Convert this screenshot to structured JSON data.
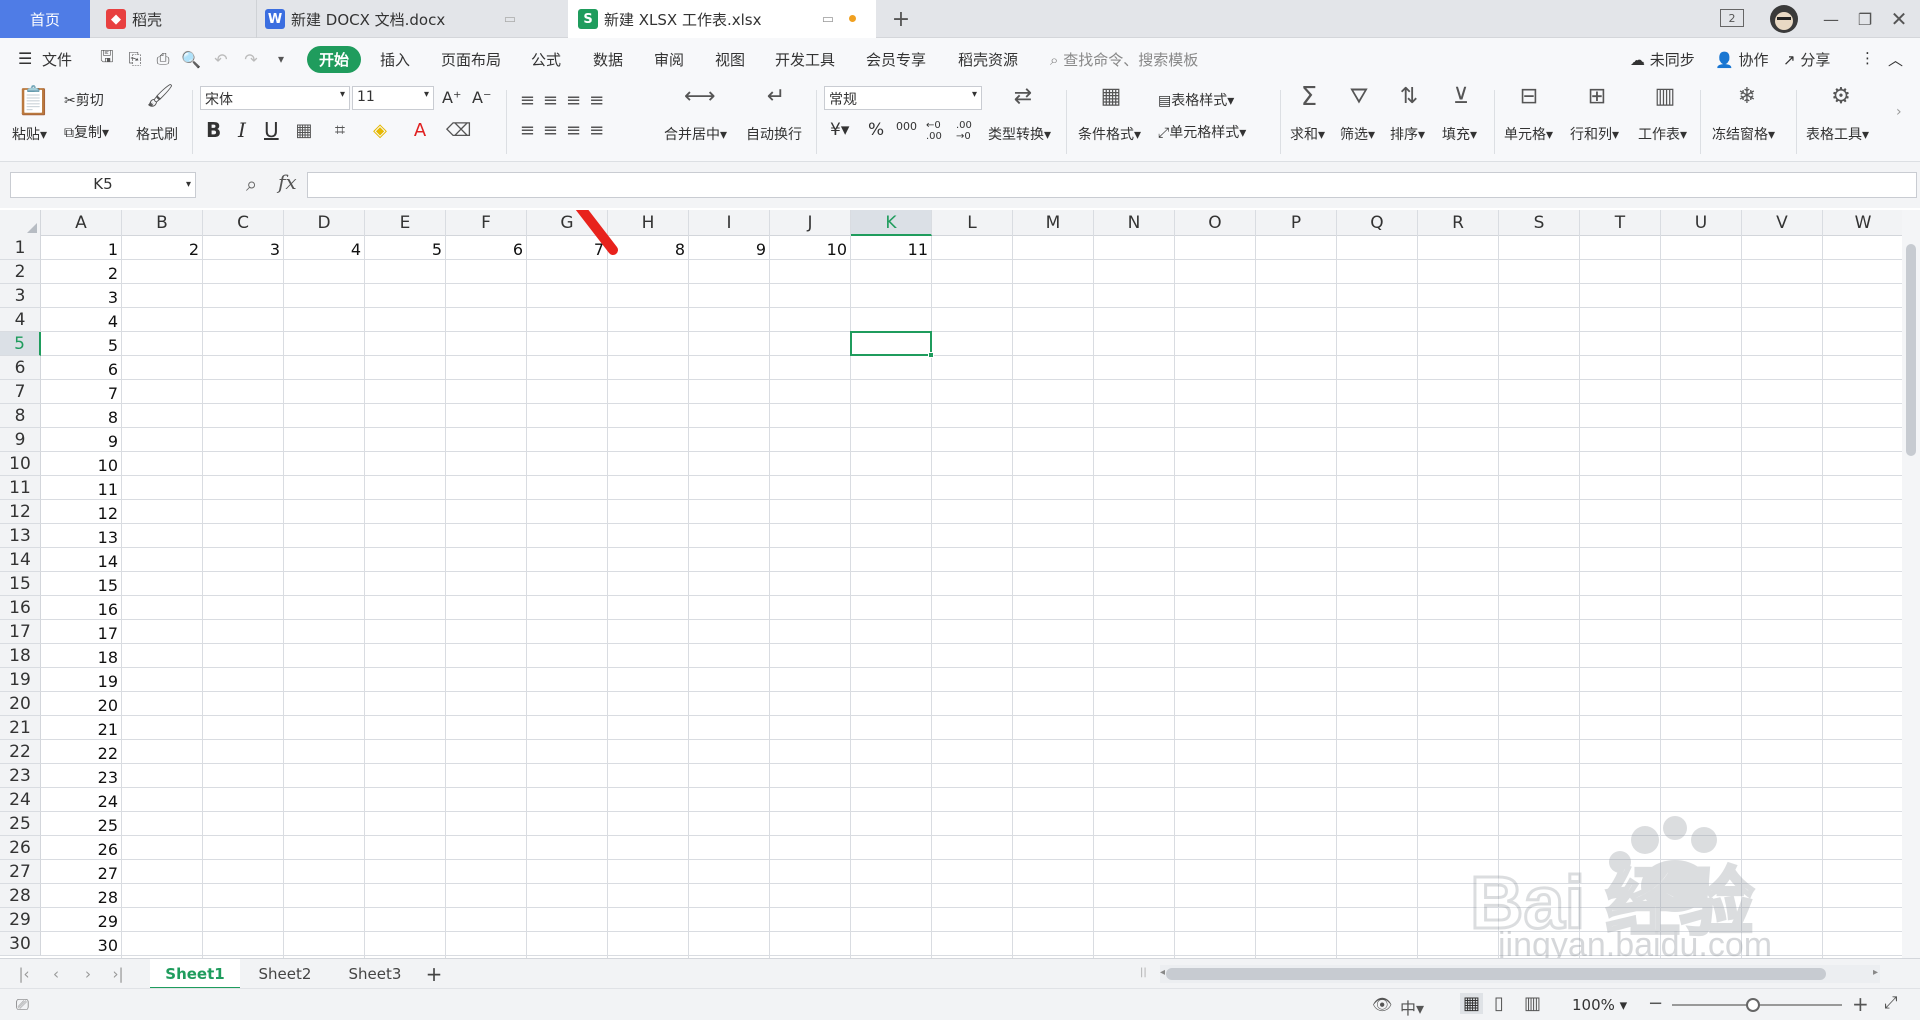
{
  "tabs": {
    "home": "首页",
    "daoke": "稻壳",
    "docx": "新建 DOCX 文档.docx",
    "xlsx": "新建 XLSX 工作表.xlsx",
    "add": "+",
    "window_count": "2"
  },
  "menu": {
    "file": "文件",
    "items": [
      "开始",
      "插入",
      "页面布局",
      "公式",
      "数据",
      "审阅",
      "视图",
      "开发工具",
      "会员专享",
      "稻壳资源"
    ],
    "search_placeholder": "查找命令、搜索模板",
    "unsynced": "未同步",
    "collab": "协作",
    "share": "分享"
  },
  "ribbon": {
    "paste": "粘贴",
    "cut": "剪切",
    "copy": "复制",
    "format_painter": "格式刷",
    "font": "宋体",
    "font_size": "11",
    "bold": "B",
    "italic": "I",
    "underline": "U",
    "grow": "A⁺",
    "shrink": "A⁻",
    "merge_center": "合并居中",
    "wrap": "自动换行",
    "number_format": "常规",
    "currency": "¥",
    "percent": "%",
    "thousands": "000",
    "inc_dec": "←0 .00",
    "dec_dec": ".00 →0",
    "type_convert": "类型转换",
    "cond_format": "条件格式",
    "table_style": "表格样式",
    "cell_style": "单元格样式",
    "sum": "求和",
    "filter": "筛选",
    "sort": "排序",
    "fill": "填充",
    "cell": "单元格",
    "rowcol": "行和列",
    "worksheet": "工作表",
    "freeze": "冻结窗格",
    "table_tools": "表格工具"
  },
  "formula": {
    "name_box": "K5",
    "fx": "fx",
    "content": ""
  },
  "sheet": {
    "columns": [
      "A",
      "B",
      "C",
      "D",
      "E",
      "F",
      "G",
      "H",
      "I",
      "J",
      "K",
      "L",
      "M",
      "N",
      "O",
      "P",
      "Q",
      "R",
      "S",
      "T",
      "U",
      "V",
      "W"
    ],
    "rows": [
      "1",
      "2",
      "3",
      "4",
      "5",
      "6",
      "7",
      "8",
      "9",
      "10",
      "11",
      "12",
      "13",
      "14",
      "15",
      "16",
      "17",
      "18",
      "19",
      "20",
      "21",
      "22",
      "23",
      "24",
      "25",
      "26",
      "27",
      "28",
      "29",
      "30"
    ],
    "active_col": "K",
    "active_row": "5",
    "row1_values": [
      "1",
      "2",
      "3",
      "4",
      "5",
      "6",
      "7",
      "8",
      "9",
      "10",
      "11"
    ],
    "colA_values": [
      "1",
      "2",
      "3",
      "4",
      "5",
      "6",
      "7",
      "8",
      "9",
      "10",
      "11",
      "12",
      "13",
      "14",
      "15",
      "16",
      "17",
      "18",
      "19",
      "20",
      "21",
      "22",
      "23",
      "24",
      "25",
      "26",
      "27",
      "28",
      "29",
      "30"
    ]
  },
  "sheets": [
    "Sheet1",
    "Sheet2",
    "Sheet3"
  ],
  "status": {
    "zoom": "100%"
  },
  "colors": {
    "accent_green": "#1f9c5d",
    "home_tab_blue": "#4f7ce6",
    "annotation_red": "#e8221c"
  },
  "watermark": {
    "brand": "Bai 经验",
    "url": "jingyan.baidu.com"
  }
}
